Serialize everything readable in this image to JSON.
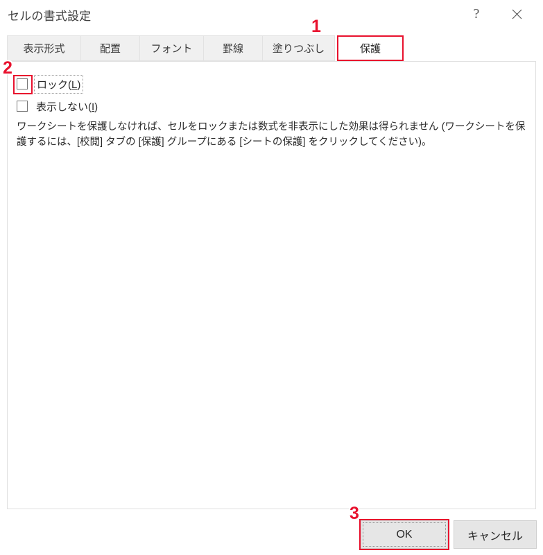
{
  "window": {
    "title": "セルの書式設定",
    "help_icon": "question-mark-icon",
    "close_icon": "close-icon",
    "accent_color": "#e8112d",
    "background_color": "#efefef"
  },
  "tabs": [
    {
      "id": "hyojikeishiki",
      "label": "表示形式",
      "selected": false
    },
    {
      "id": "haichi",
      "label": "配置",
      "selected": false
    },
    {
      "id": "font",
      "label": "フォント",
      "selected": false
    },
    {
      "id": "keisen",
      "label": "罫線",
      "selected": false
    },
    {
      "id": "nuritsubushi",
      "label": "塗りつぶし",
      "selected": false
    },
    {
      "id": "hogo",
      "label": "保護",
      "selected": true
    }
  ],
  "protection_panel": {
    "checkboxes": [
      {
        "id": "lock",
        "label_prefix": "ロック(",
        "accelerator": "L",
        "label_suffix": ")",
        "checked": false,
        "focused": true,
        "highlighted": true
      },
      {
        "id": "hidden",
        "label_prefix": "表示しない(",
        "accelerator": "I",
        "label_suffix": ")",
        "checked": false,
        "focused": false,
        "highlighted": false
      }
    ],
    "description": "ワークシートを保護しなければ、セルをロックまたは数式を非表示にした効果は得られません (ワークシートを保護するには、[校閲] タブの [保護] グループにある [シートの保護] をクリックしてください)。"
  },
  "footer": {
    "ok_label": "OK",
    "cancel_label": "キャンセル"
  },
  "annotations": {
    "step_1": "1",
    "step_2": "2",
    "step_3": "3"
  }
}
